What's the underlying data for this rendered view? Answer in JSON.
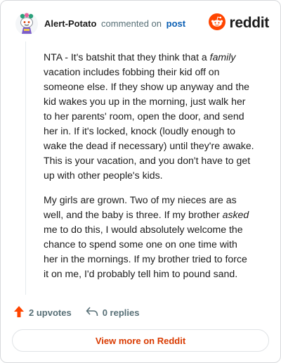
{
  "comment": {
    "username": "Alert-Potato",
    "meta_text": "commented on",
    "post_link": "post",
    "logo_text": "reddit",
    "paragraph1": {
      "before_italic": "NTA - It's batshit that they think that a ",
      "italic": "family",
      "after_italic": " vacation includes fobbing their kid off on someone else. If they show up anyway and the kid wakes you up in the morning, just walk her to her parents' room, open the door, and send her in. If it's locked, knock (loudly enough to wake the dead if necessary) until they're awake. This is your vacation, and you don't have to get up with other people's kids."
    },
    "paragraph2": {
      "before_italic": "My girls are grown. Two of my nieces are as well, and the baby is three. If my brother ",
      "italic": "asked",
      "after_italic": " me to do this, I would absolutely welcome the chance to spend some one on one time with her in the mornings. If my brother tried to force it on me, I'd probably tell him to pound sand."
    },
    "upvotes": "2 upvotes",
    "replies": "0 replies",
    "view_more": "View more on Reddit"
  },
  "colors": {
    "brand": "#ff4500",
    "link": "#0a5fb4",
    "view_more": "#d93a00",
    "muted": "#576f76"
  },
  "icons": {
    "avatar": "snoo-avatar-icon",
    "logo": "reddit-snoo-icon",
    "upvote": "upvote-arrow-icon",
    "reply": "reply-arrow-icon"
  }
}
